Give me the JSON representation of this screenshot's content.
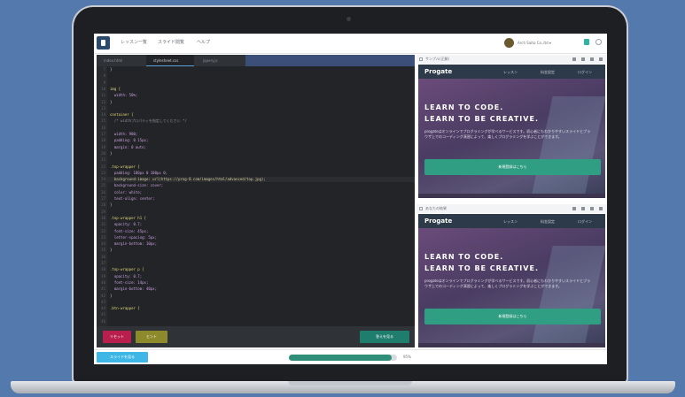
{
  "nav": {
    "menu": [
      "レッスン一覧",
      "スライド閲覧",
      "ヘルプ"
    ],
    "user": "Arch Saito Co.,ltd ▾"
  },
  "editor": {
    "tabs": [
      "index.html",
      "stylesheet.css",
      "jquery.js"
    ],
    "lines": [
      {
        "n": "7",
        "t": "}",
        "k": "br"
      },
      {
        "n": "8",
        "t": "",
        "k": "br"
      },
      {
        "n": "9",
        "t": "",
        "k": "br"
      },
      {
        "n": "10",
        "t": "img {",
        "k": "sel"
      },
      {
        "n": "11",
        "t": "  width: 50%;",
        "k": "prop"
      },
      {
        "n": "12",
        "t": "}",
        "k": "br"
      },
      {
        "n": "13",
        "t": "",
        "k": "br"
      },
      {
        "n": "14",
        "t": "container {",
        "k": "sel"
      },
      {
        "n": "15",
        "t": "  /* widthプロパティを指定してください */",
        "k": "cmt"
      },
      {
        "n": "16",
        "t": "",
        "k": "br"
      },
      {
        "n": "17",
        "t": "  width: 980;",
        "k": "prop"
      },
      {
        "n": "18",
        "t": "  padding: 0 15px;",
        "k": "prop"
      },
      {
        "n": "19",
        "t": "  margin: 0 auto;",
        "k": "prop"
      },
      {
        "n": "20",
        "t": "}",
        "k": "br"
      },
      {
        "n": "21",
        "t": "",
        "k": "br"
      },
      {
        "n": "22",
        "t": ".top-wrapper {",
        "k": "sel"
      },
      {
        "n": "23",
        "t": "  padding: 180px 0 100px 0;",
        "k": "prop"
      },
      {
        "n": "24",
        "t": "  background-image: url(https://prog-8.com/images/html/advanced/top.jpg);",
        "k": "val"
      },
      {
        "n": "25",
        "t": "  background-size: cover;",
        "k": "prop"
      },
      {
        "n": "26",
        "t": "  color: white;",
        "k": "prop"
      },
      {
        "n": "27",
        "t": "  text-align: center;",
        "k": "prop"
      },
      {
        "n": "28",
        "t": "}",
        "k": "br"
      },
      {
        "n": "29",
        "t": "",
        "k": "br"
      },
      {
        "n": "30",
        "t": ".top-wrapper h1 {",
        "k": "sel"
      },
      {
        "n": "31",
        "t": "  opacity: 0.7;",
        "k": "prop"
      },
      {
        "n": "32",
        "t": "  font-size: 45px;",
        "k": "prop"
      },
      {
        "n": "33",
        "t": "  letter-spacing: 5px;",
        "k": "prop"
      },
      {
        "n": "34",
        "t": "  margin-bottom: 10px;",
        "k": "prop"
      },
      {
        "n": "35",
        "t": "}",
        "k": "br"
      },
      {
        "n": "36",
        "t": "",
        "k": "br"
      },
      {
        "n": "37",
        "t": "",
        "k": "br"
      },
      {
        "n": "38",
        "t": ".top-wrapper p {",
        "k": "sel"
      },
      {
        "n": "39",
        "t": "  opacity: 0.7;",
        "k": "prop"
      },
      {
        "n": "40",
        "t": "  font-size: 14px;",
        "k": "prop"
      },
      {
        "n": "41",
        "t": "  margin-bottom: 40px;",
        "k": "prop"
      },
      {
        "n": "42",
        "t": "}",
        "k": "br"
      },
      {
        "n": "43",
        "t": "",
        "k": "br"
      },
      {
        "n": "44",
        "t": ".btn-wrapper {",
        "k": "sel"
      },
      {
        "n": "45",
        "t": "",
        "k": "br"
      },
      {
        "n": "46",
        "t": "",
        "k": "br"
      }
    ],
    "highlight_line": 24,
    "footer": {
      "reset_label": "リセット",
      "hint_label": "ヒント",
      "submit_label": "答えを見る"
    }
  },
  "preview_top": {
    "title": "サンプル(正解)",
    "logo": "Progate",
    "nav": [
      "レッスン",
      "料金設定",
      "ログイン"
    ],
    "hero_line1": "LEARN TO CODE.",
    "hero_line2": "LEARN TO BE CREATIVE.",
    "subtext": "progateはオンラインでプログラミングが学べるサービスです。初心者にもわかりやすいスライドとブラウザ上でのコーディング演習によって、楽しくプログラミングを学ぶことができます。",
    "button": "新規登録はこちら"
  },
  "preview_bottom": {
    "title": "あなたの結果",
    "logo": "Progate",
    "nav": [
      "レッスン",
      "料金設定",
      "ログイン"
    ],
    "hero_line1": "LEARN TO CODE.",
    "hero_line2": "LEARN TO BE CREATIVE.",
    "subtext": "progateはオンラインでプログラミングが学べるサービスです。初心者にもわかりやすいスライドとブラウザ上でのコーディング演習によって、楽しくプログラミングを学ぶことができます。",
    "button": "新規登録はこちら"
  },
  "bottom": {
    "slides_button": "スライドを見る",
    "progress_fraction": 0.95,
    "progress_label": "95%"
  },
  "colors": {
    "background": "#5479ad",
    "accent_green": "#2f9e82",
    "reset_red": "#b81f4d",
    "hint_olive": "#8d8a2c",
    "submit_teal": "#1f7d6e",
    "slides_blue": "#3fb7e6"
  }
}
